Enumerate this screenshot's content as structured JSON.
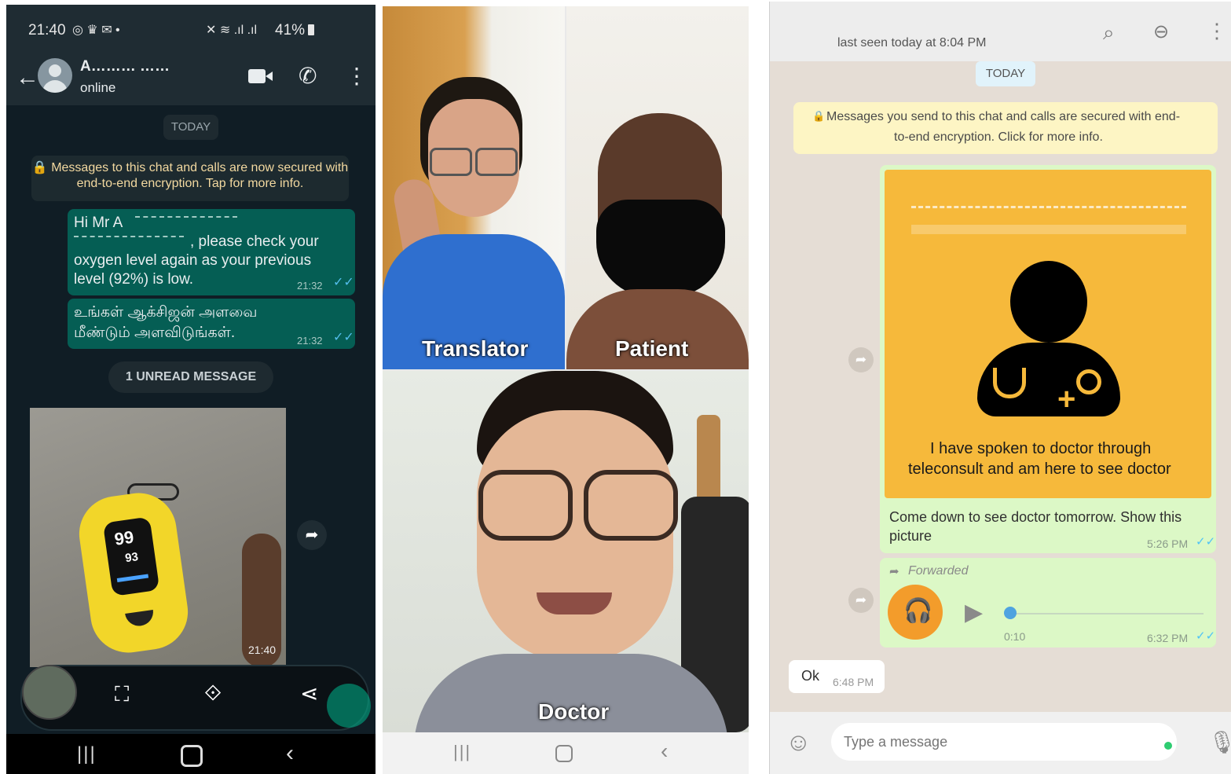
{
  "left_phone": {
    "status_time": "21:40",
    "battery": "41%",
    "contact_name": "A……… ……",
    "contact_status": "online",
    "date_chip": "TODAY",
    "encryption_notice": "🔒 Messages to this chat and calls are now secured with end-to-end encryption. Tap for more info.",
    "messages": [
      {
        "text_line1": "Hi Mr A",
        "text_line2": ", please check your",
        "text_line3": "oxygen level again as your previous",
        "text_line4": "level (92%) is low.",
        "time": "21:32"
      },
      {
        "text_line1": "உங்கள் ஆக்சிஜன் அளவை",
        "text_line2": "மீண்டும் அளவிடுங்கள்.",
        "time": "21:32"
      }
    ],
    "unread_chip": "1 UNREAD MESSAGE",
    "image_time": "21:40",
    "oximeter_spo2": "99",
    "oximeter_pr": "93"
  },
  "video_call": {
    "labels": {
      "translator": "Translator",
      "patient": "Patient",
      "doctor": "Doctor"
    }
  },
  "right_web": {
    "last_seen": "last seen today at 8:04 PM",
    "date_chip": "TODAY",
    "encryption_notice_line1": "Messages you send to this chat and calls are secured with end-",
    "encryption_notice_line2": "to-end encryption. Click for more info.",
    "card_caption_line1": "I have spoken to doctor through",
    "card_caption_line2": "teleconsult and am here to see doctor",
    "message_text_line1": "Come down to see doctor tomorrow. Show this",
    "message_text_line2": "picture",
    "message_time": "5:26 PM",
    "forwarded_label": "Forwarded",
    "audio_duration": "0:10",
    "audio_time": "6:32 PM",
    "reply_text": "Ok",
    "reply_time": "6:48 PM",
    "input_placeholder": "Type a message",
    "colors": {
      "card_bg": "#f6b93b",
      "audio_icon": "#f39c2b",
      "tick": "#4fc3f7"
    }
  }
}
